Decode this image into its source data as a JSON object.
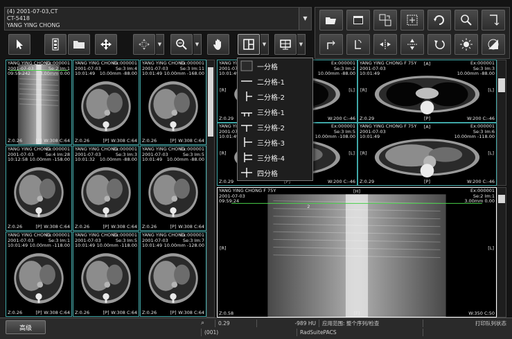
{
  "series": {
    "line1": "(4) 2001-07-03,CT",
    "line2": "CT-5418",
    "line3": "YANG YING CHONG"
  },
  "icons": {
    "pointer": "arrow-pointer-icon",
    "series_list": "list-icon",
    "folder": "folder-icon",
    "move": "move-icon",
    "pan": "pan-arrows-icon",
    "zoom": "zoom-icon",
    "hand": "hand-icon",
    "layout": "layout-icon",
    "monitor": "monitor-icon"
  },
  "colors": {
    "viewport_border": "#3fa7a7",
    "active_border": "#ffffff",
    "background": "#141414"
  },
  "layout_menu": {
    "items": [
      {
        "label": "一分格"
      },
      {
        "label": "二分格-1"
      },
      {
        "label": "二分格-2"
      },
      {
        "label": "三分格-1"
      },
      {
        "label": "三分格-2"
      },
      {
        "label": "三分格-3"
      },
      {
        "label": "三分格-4"
      },
      {
        "label": "四分格"
      }
    ]
  },
  "thumbs": [
    {
      "tl": "YANG YING CHONG\n2001-07-03\n09:59:24",
      "tr": "Ex:000001\nSe:2 Im:1\n3.00mm 0.00",
      "bl": "Z:0.26",
      "bc": "[P]",
      "br": "W:308\nC:64",
      "marker": "2"
    },
    {
      "tl": "YANG YING CHONG\n2001-07-03\n10:01:49",
      "tr": "Ex:000001\nSe:3 Im:4\n10.00mm -88.00",
      "bl": "Z:0.26",
      "bc": "[P]",
      "br": "W:308\nC:64"
    },
    {
      "tl": "YANG YING CHONG\n2001-07-03\n10:01:49",
      "tr": "Ex:000001\nSe:3 Im:11\n10.00mm -168.00",
      "bl": "Z:0.26",
      "bc": "[P]",
      "br": "W:308\nC:64"
    },
    {
      "tl": "YANG YING CHONG\n2001-07-03\n10:12:58",
      "tr": "Ex:000001\nSe:4 Im:28\n10.00mm -158.00",
      "bl": "Z:0.26",
      "bc": "[P]",
      "br": "W:308\nC:64"
    },
    {
      "tl": "YANG YING CHONG\n2001-07-03\n10:01:32",
      "tr": "Ex:000001\nSe:3 Im:3\n10.00mm -88.00",
      "bl": "Z:0.26",
      "bc": "[P]",
      "br": "W:308\nC:64"
    },
    {
      "tl": "YANG YING CHONG\n2001-07-03\n10:01:49",
      "tr": "Ex:000001\nSe:3 Im:5\n10.00mm -88.00",
      "bl": "Z:0.26",
      "bc": "[P]",
      "br": "W:308\nC:64"
    },
    {
      "tl": "YANG YING CHONG\n2001-07-03\n10:01:49",
      "tr": "Ex:000001\nSe:3 Im:1\n10.00mm -118.00",
      "bl": "Z:0.26",
      "bc": "[P]",
      "br": "W:308\nC:64"
    },
    {
      "tl": "YANG YING CHONG\n2001-07-03\n10:01:49",
      "tr": "Ex:000001\nSe:3 Im:5\n10.00mm -118.00",
      "bl": "Z:0.26",
      "bc": "[P]",
      "br": "W:308\nC:64"
    },
    {
      "tl": "YANG YING CHONG\n2001-07-03\n10:01:49",
      "tr": "Ex:000001\nSe:3 Im:7\n10.00mm -128.00",
      "bl": "Z:0.26",
      "bc": "[P]",
      "br": "W:308\nC:64"
    }
  ],
  "big_views": {
    "v1": {
      "tl": "YANG YING CHONG F 75Y\n2001-07-03\n10:01:49",
      "tr": "Ex:000001\nSe:3 Im:2\n10.00mm -88.00",
      "bl": "Z:0.29",
      "bc": "[P]",
      "br": "W:200\nC:-46",
      "l": "[R]",
      "r": "[L]",
      "t": "[A]"
    },
    "v2": {
      "tl": "YANG YING CHONG F 75Y\n2001-07-03\n10:01:49",
      "tr": "Ex:000001\nSe:3 Im:3\n10.00mm -88.00",
      "bl": "Z:0.29",
      "bc": "[P]",
      "br": "W:200\nC:-46",
      "l": "[R]",
      "r": "[L]",
      "t": "[A]"
    },
    "v3": {
      "tl": "YANG YING CHONG F 75Y\n2001-07-03\n10:01:49",
      "tr": "Ex:000001\nSe:3 Im:5\n10.00mm -108.00",
      "bl": "Z:0.29",
      "bc": "[P]",
      "br": "W:200\nC:-46",
      "l": "[R]",
      "r": "[L]",
      "t": "[A]"
    },
    "v4": {
      "tl": "YANG YING CHONG F 75Y\n2001-07-03\n10:01:49",
      "tr": "Ex:000001\nSe:3 Im:6\n10.00mm -118.00",
      "bl": "Z:0.29",
      "bc": "[P]",
      "br": "W:200\nC:-46",
      "l": "[R]",
      "r": "[L]",
      "t": "[A]"
    },
    "v5": {
      "tl": "YANG YING CHONG F 75Y\n2001-07-03\n09:59:24",
      "tr": "Ex:000001\nSe:2 Im:1\n3.00mm 0.00",
      "bl": "Z:0.58",
      "bc": "[F]",
      "br": "W:350\nC:50",
      "l": "[R]",
      "r": "[L]",
      "t": "[H]",
      "marker": "2"
    }
  },
  "statusbar": {
    "advanced": "高级",
    "zoom": "0.29",
    "hu": "-989 HU",
    "scope": "应用范围: 整个序列/检查",
    "print_queue": "打印队列状态",
    "count": "(001)",
    "product": "RadSuitePACS"
  }
}
